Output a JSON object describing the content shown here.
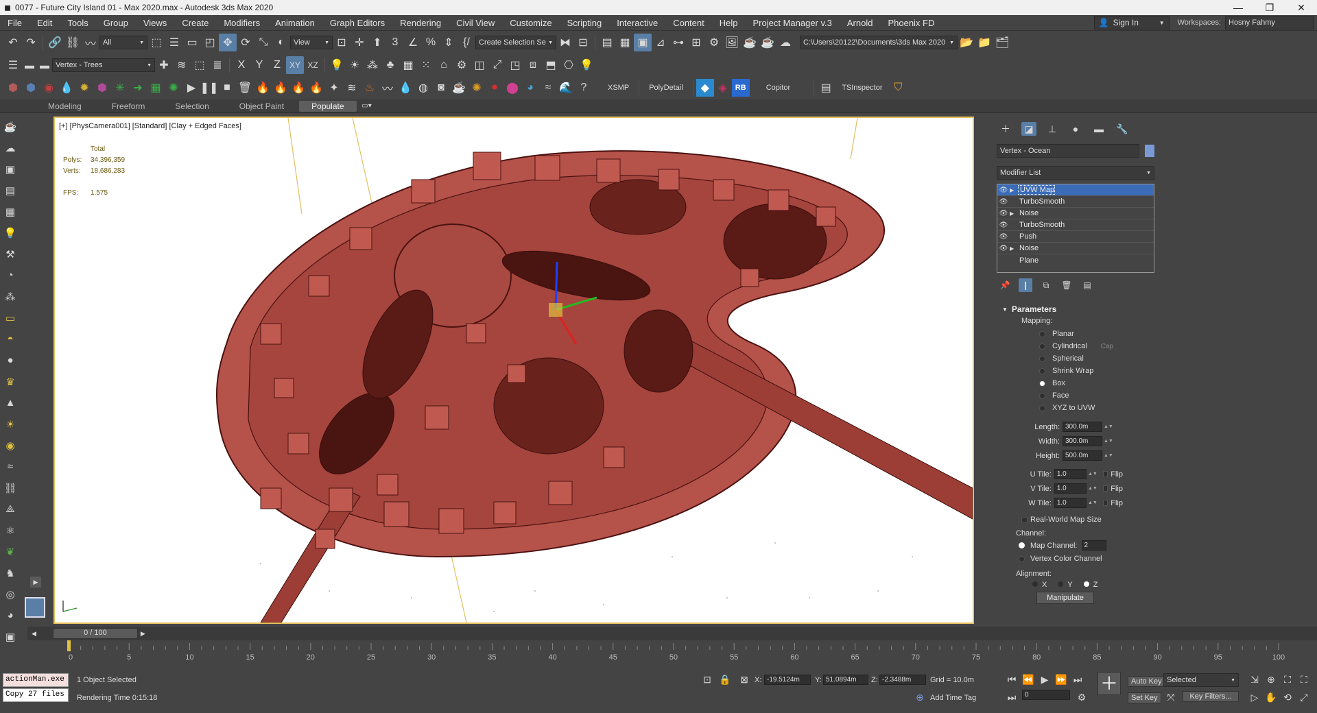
{
  "window": {
    "title": "0077 - Future City Island 01 - Max 2020.max - Autodesk 3ds Max 2020",
    "controls": [
      "—",
      "❐",
      "✕"
    ]
  },
  "menu": {
    "items": [
      "File",
      "Edit",
      "Tools",
      "Group",
      "Views",
      "Create",
      "Modifiers",
      "Animation",
      "Graph Editors",
      "Rendering",
      "Civil View",
      "Customize",
      "Scripting",
      "Interactive",
      "Content",
      "Help",
      "Project Manager v.3",
      "Arnold",
      "Phoenix FD"
    ],
    "sign_in": "Sign In",
    "workspaces_label": "Workspaces:",
    "workspace_value": "Hosny Fahmy"
  },
  "toolbar1": {
    "filter_value": "All",
    "view_value": "View",
    "selection_set_placeholder": "Create Selection Se",
    "project_path": "C:\\Users\\20122\\Documents\\3ds Max 2020"
  },
  "toolbar2": {
    "layer_value": "Vertex - Trees",
    "axes": [
      "X",
      "Y",
      "Z",
      "XY",
      "XZ"
    ]
  },
  "toolbar3": {
    "labels": [
      "XSMP",
      "PolyDetail",
      "RB",
      "Copitor",
      "TSInspector"
    ]
  },
  "ribbon": {
    "tabs": [
      "Modeling",
      "Freeform",
      "Selection",
      "Object Paint",
      "Populate"
    ],
    "active": "Populate"
  },
  "viewport": {
    "label": "[+] [PhysCamera001] [Standard] [Clay + Edged Faces]",
    "stats_title": "Total",
    "polys_label": "Polys:",
    "polys_value": "34,396,359",
    "verts_label": "Verts:",
    "verts_value": "18,686,283",
    "fps_label": "FPS:",
    "fps_value": "1.575",
    "mesh_color": "#b5524a",
    "wire_color": "#4a1210"
  },
  "command_panel": {
    "object_name": "Vertex - Ocean",
    "modifier_list": "Modifier List",
    "stack": [
      "UVW Map",
      "TurboSmooth",
      "Noise",
      "TurboSmooth",
      "Push",
      "Noise",
      "Plane"
    ],
    "selected_modifier": "UVW Map",
    "parameters_title": "Parameters",
    "mapping_label": "Mapping:",
    "mapping_options": [
      "Planar",
      "Cylindrical",
      "Spherical",
      "Shrink Wrap",
      "Box",
      "Face",
      "XYZ to UVW"
    ],
    "mapping_selected": "Box",
    "cap_label": "Cap",
    "length_label": "Length:",
    "length_value": "300.0m",
    "width_label": "Width:",
    "width_value": "300.0m",
    "height_label": "Height:",
    "height_value": "500.0m",
    "utile_label": "U Tile:",
    "utile_value": "1.0",
    "vtile_label": "V Tile:",
    "vtile_value": "1.0",
    "wtile_label": "W Tile:",
    "wtile_value": "1.0",
    "flip_label": "Flip",
    "realworld_label": "Real-World Map Size",
    "channel_label": "Channel:",
    "map_channel_label": "Map Channel:",
    "map_channel_value": "2",
    "vertex_color_label": "Vertex Color Channel",
    "alignment_label": "Alignment:",
    "align_axes": [
      "X",
      "Y",
      "Z"
    ],
    "align_selected": "Z",
    "manipulate": "Manipulate"
  },
  "timeline": {
    "frame_display": "0 / 100",
    "ticks": [
      "0",
      "5",
      "10",
      "15",
      "20",
      "25",
      "30",
      "35",
      "40",
      "45",
      "50",
      "55",
      "60",
      "65",
      "70",
      "75",
      "80",
      "85",
      "90",
      "95",
      "100"
    ]
  },
  "status": {
    "maxscript_line1": "actionMan.exe",
    "maxscript_line2": "Copy 27 files",
    "selection": "1 Object Selected",
    "render_time": "Rendering Time  0:15:18",
    "x_label": "X:",
    "x_value": "-19.5124m",
    "y_label": "Y:",
    "y_value": "51.0894m",
    "z_label": "Z:",
    "z_value": "-2.3488m",
    "grid": "Grid = 10.0m",
    "add_time_tag": "Add Time Tag",
    "auto_key": "Auto Key",
    "set_key": "Set Key",
    "selected_dd": "Selected",
    "key_filters": "Key Filters...",
    "current_frame": "0"
  }
}
